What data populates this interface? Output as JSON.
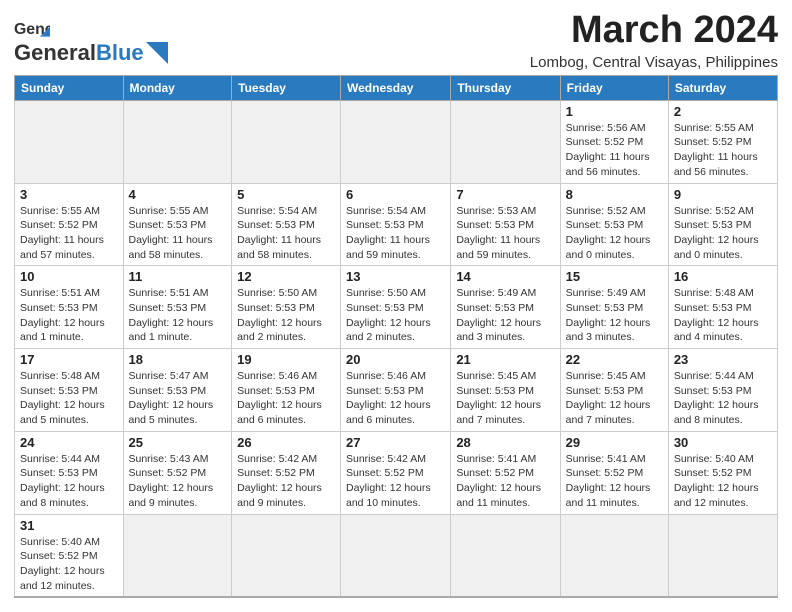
{
  "header": {
    "logo_general": "General",
    "logo_blue": "Blue",
    "month_title": "March 2024",
    "location": "Lombog, Central Visayas, Philippines"
  },
  "weekdays": [
    "Sunday",
    "Monday",
    "Tuesday",
    "Wednesday",
    "Thursday",
    "Friday",
    "Saturday"
  ],
  "weeks": [
    [
      {
        "day": "",
        "info": ""
      },
      {
        "day": "",
        "info": ""
      },
      {
        "day": "",
        "info": ""
      },
      {
        "day": "",
        "info": ""
      },
      {
        "day": "",
        "info": ""
      },
      {
        "day": "1",
        "info": "Sunrise: 5:56 AM\nSunset: 5:52 PM\nDaylight: 11 hours\nand 56 minutes."
      },
      {
        "day": "2",
        "info": "Sunrise: 5:55 AM\nSunset: 5:52 PM\nDaylight: 11 hours\nand 56 minutes."
      }
    ],
    [
      {
        "day": "3",
        "info": "Sunrise: 5:55 AM\nSunset: 5:52 PM\nDaylight: 11 hours\nand 57 minutes."
      },
      {
        "day": "4",
        "info": "Sunrise: 5:55 AM\nSunset: 5:53 PM\nDaylight: 11 hours\nand 58 minutes."
      },
      {
        "day": "5",
        "info": "Sunrise: 5:54 AM\nSunset: 5:53 PM\nDaylight: 11 hours\nand 58 minutes."
      },
      {
        "day": "6",
        "info": "Sunrise: 5:54 AM\nSunset: 5:53 PM\nDaylight: 11 hours\nand 59 minutes."
      },
      {
        "day": "7",
        "info": "Sunrise: 5:53 AM\nSunset: 5:53 PM\nDaylight: 11 hours\nand 59 minutes."
      },
      {
        "day": "8",
        "info": "Sunrise: 5:52 AM\nSunset: 5:53 PM\nDaylight: 12 hours\nand 0 minutes."
      },
      {
        "day": "9",
        "info": "Sunrise: 5:52 AM\nSunset: 5:53 PM\nDaylight: 12 hours\nand 0 minutes."
      }
    ],
    [
      {
        "day": "10",
        "info": "Sunrise: 5:51 AM\nSunset: 5:53 PM\nDaylight: 12 hours\nand 1 minute."
      },
      {
        "day": "11",
        "info": "Sunrise: 5:51 AM\nSunset: 5:53 PM\nDaylight: 12 hours\nand 1 minute."
      },
      {
        "day": "12",
        "info": "Sunrise: 5:50 AM\nSunset: 5:53 PM\nDaylight: 12 hours\nand 2 minutes."
      },
      {
        "day": "13",
        "info": "Sunrise: 5:50 AM\nSunset: 5:53 PM\nDaylight: 12 hours\nand 2 minutes."
      },
      {
        "day": "14",
        "info": "Sunrise: 5:49 AM\nSunset: 5:53 PM\nDaylight: 12 hours\nand 3 minutes."
      },
      {
        "day": "15",
        "info": "Sunrise: 5:49 AM\nSunset: 5:53 PM\nDaylight: 12 hours\nand 3 minutes."
      },
      {
        "day": "16",
        "info": "Sunrise: 5:48 AM\nSunset: 5:53 PM\nDaylight: 12 hours\nand 4 minutes."
      }
    ],
    [
      {
        "day": "17",
        "info": "Sunrise: 5:48 AM\nSunset: 5:53 PM\nDaylight: 12 hours\nand 5 minutes."
      },
      {
        "day": "18",
        "info": "Sunrise: 5:47 AM\nSunset: 5:53 PM\nDaylight: 12 hours\nand 5 minutes."
      },
      {
        "day": "19",
        "info": "Sunrise: 5:46 AM\nSunset: 5:53 PM\nDaylight: 12 hours\nand 6 minutes."
      },
      {
        "day": "20",
        "info": "Sunrise: 5:46 AM\nSunset: 5:53 PM\nDaylight: 12 hours\nand 6 minutes."
      },
      {
        "day": "21",
        "info": "Sunrise: 5:45 AM\nSunset: 5:53 PM\nDaylight: 12 hours\nand 7 minutes."
      },
      {
        "day": "22",
        "info": "Sunrise: 5:45 AM\nSunset: 5:53 PM\nDaylight: 12 hours\nand 7 minutes."
      },
      {
        "day": "23",
        "info": "Sunrise: 5:44 AM\nSunset: 5:53 PM\nDaylight: 12 hours\nand 8 minutes."
      }
    ],
    [
      {
        "day": "24",
        "info": "Sunrise: 5:44 AM\nSunset: 5:53 PM\nDaylight: 12 hours\nand 8 minutes."
      },
      {
        "day": "25",
        "info": "Sunrise: 5:43 AM\nSunset: 5:52 PM\nDaylight: 12 hours\nand 9 minutes."
      },
      {
        "day": "26",
        "info": "Sunrise: 5:42 AM\nSunset: 5:52 PM\nDaylight: 12 hours\nand 9 minutes."
      },
      {
        "day": "27",
        "info": "Sunrise: 5:42 AM\nSunset: 5:52 PM\nDaylight: 12 hours\nand 10 minutes."
      },
      {
        "day": "28",
        "info": "Sunrise: 5:41 AM\nSunset: 5:52 PM\nDaylight: 12 hours\nand 11 minutes."
      },
      {
        "day": "29",
        "info": "Sunrise: 5:41 AM\nSunset: 5:52 PM\nDaylight: 12 hours\nand 11 minutes."
      },
      {
        "day": "30",
        "info": "Sunrise: 5:40 AM\nSunset: 5:52 PM\nDaylight: 12 hours\nand 12 minutes."
      }
    ],
    [
      {
        "day": "31",
        "info": "Sunrise: 5:40 AM\nSunset: 5:52 PM\nDaylight: 12 hours\nand 12 minutes."
      },
      {
        "day": "",
        "info": ""
      },
      {
        "day": "",
        "info": ""
      },
      {
        "day": "",
        "info": ""
      },
      {
        "day": "",
        "info": ""
      },
      {
        "day": "",
        "info": ""
      },
      {
        "day": "",
        "info": ""
      }
    ]
  ]
}
